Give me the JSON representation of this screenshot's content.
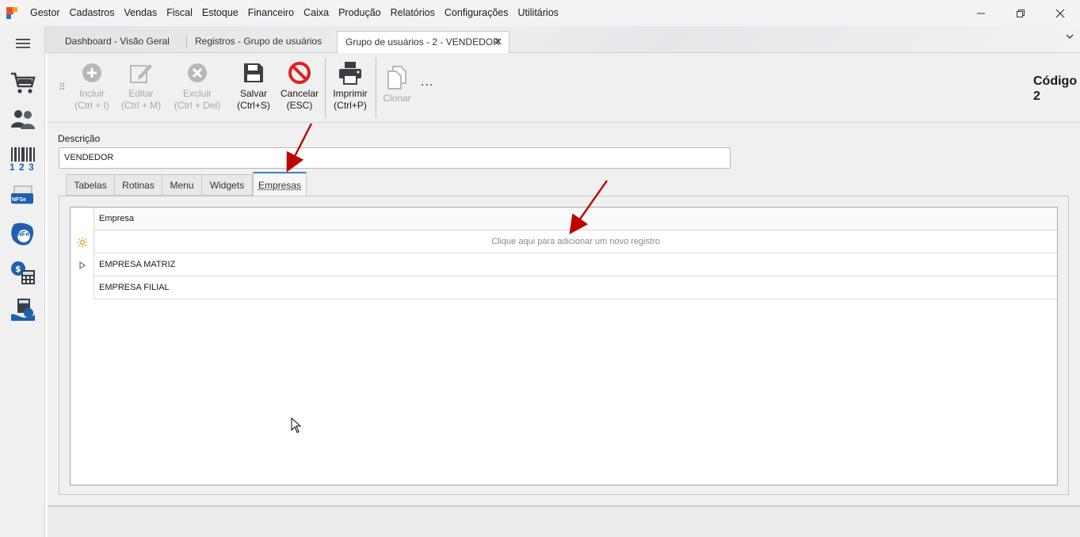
{
  "app": {
    "title": "Gestor",
    "menu": [
      "Cadastros",
      "Vendas",
      "Fiscal",
      "Estoque",
      "Financeiro",
      "Caixa",
      "Produção",
      "Relatórios",
      "Configurações",
      "Utilitários"
    ],
    "window_controls": [
      "minimize",
      "restore",
      "close"
    ]
  },
  "sidebar": {
    "items": [
      {
        "name": "hamburger-menu-icon"
      },
      {
        "name": "shopping-cart-icon"
      },
      {
        "name": "users-icon"
      },
      {
        "name": "barcode-icon",
        "caption": "1 2 3"
      },
      {
        "name": "nfse-icon",
        "caption": "NFSe"
      },
      {
        "name": "nfe-icon",
        "caption": "NFe"
      },
      {
        "name": "finance-calculator-icon"
      },
      {
        "name": "cashier-icon"
      }
    ]
  },
  "doc_tabs": [
    {
      "label": "Dashboard - Visão Geral",
      "active": false
    },
    {
      "label": "Registros - Grupo de usuários",
      "active": false
    },
    {
      "label": "Grupo de usuários - 2 - VENDEDOR",
      "active": true
    }
  ],
  "toolbar": {
    "incluir": {
      "line1": "Incluir",
      "line2": "(Ctrl + I)",
      "enabled": false
    },
    "editar": {
      "line1": "Editar",
      "line2": "(Ctrl + M)",
      "enabled": false
    },
    "excluir": {
      "line1": "Excluir",
      "line2": "(Ctrl + Del)",
      "enabled": false
    },
    "salvar": {
      "line1": "Salvar",
      "line2": "(Ctrl+S)",
      "enabled": true
    },
    "cancelar": {
      "line1": "Cancelar",
      "line2": "(ESC)",
      "enabled": true
    },
    "imprimir": {
      "line1": "Imprimir",
      "line2": "(Ctrl+P)",
      "enabled": true
    },
    "clonar": {
      "line1": "Clonar",
      "enabled": false
    },
    "more": "..."
  },
  "record": {
    "codigo_label": "Código",
    "codigo_value": "2"
  },
  "form": {
    "descricao_label": "Descrição",
    "descricao_value": "VENDEDOR"
  },
  "inner_tabs": [
    {
      "label": "Tabelas",
      "active": false
    },
    {
      "label": "Rotinas",
      "active": false
    },
    {
      "label": "Menu",
      "active": false
    },
    {
      "label": "Widgets",
      "active": false
    },
    {
      "label": "Empresas",
      "active": true
    }
  ],
  "grid": {
    "header": "Empresa",
    "new_row_text": "Clique aqui para adicionar um novo registro",
    "rows": [
      "EMPRESA MATRIZ",
      "EMPRESA FILIAL"
    ]
  },
  "colors": {
    "accent_blue": "#3d7fd6",
    "annotation_arrow": "#c00000",
    "cancel_red": "#e02020",
    "icon_dark": "#3a3f45",
    "disabled_gray": "#a6a6a6"
  }
}
